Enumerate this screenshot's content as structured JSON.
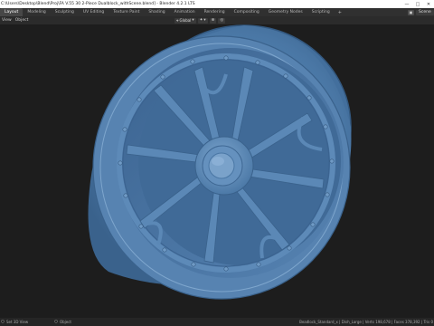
{
  "titlebar": {
    "title": "C:\\Users\\Desktop\\Blend\\Proj\\FA V.55 30 2-Piece Dualblock_withScene.blend] - Blender 4.2.1 LTS",
    "minimize_glyph": "—",
    "maximize_glyph": "□",
    "close_glyph": "✕"
  },
  "workspaces": {
    "tabs": [
      {
        "label": "Layout",
        "active": true
      },
      {
        "label": "Modeling"
      },
      {
        "label": "Sculpting"
      },
      {
        "label": "UV Editing"
      },
      {
        "label": "Texture Paint"
      },
      {
        "label": "Shading"
      },
      {
        "label": "Animation"
      },
      {
        "label": "Rendering"
      },
      {
        "label": "Compositing"
      },
      {
        "label": "Geometry Nodes"
      },
      {
        "label": "Scripting"
      }
    ],
    "add_glyph": "+",
    "scene_field": "Scene"
  },
  "header": {
    "menu": [
      "View",
      "Object"
    ],
    "orientation": "Global",
    "snap_glyph": "⊕"
  },
  "status": {
    "left": "Set 3D View",
    "mid": "Object",
    "right": "Beadlock_Standard_x | Dish_Large | Verts 198,678 | Faces 378,392 | Tris 0"
  },
  "colors": {
    "wheel": "#4d7aa8",
    "wheel_dark": "#365a82",
    "wheel_light": "#7aa4cc",
    "background": "#1d1d1d"
  }
}
